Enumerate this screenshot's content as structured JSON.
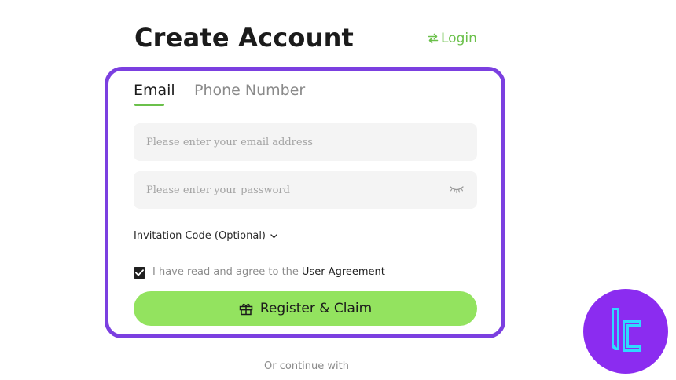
{
  "header": {
    "title": "Create Account",
    "login_label": "Login"
  },
  "tabs": {
    "email_label": "Email",
    "phone_label": "Phone Number",
    "active": "Email"
  },
  "form": {
    "email_placeholder": "Please enter your email address",
    "email_value": "",
    "password_placeholder": "Please enter your password",
    "password_value": "",
    "invitation_label": "Invitation Code (Optional)",
    "agreement_text": "I have read and agree to the",
    "agreement_link": "User Agreement",
    "agreement_checked": true,
    "register_label": "Register & Claim"
  },
  "footer": {
    "continue_text": "Or continue with"
  },
  "icons": {
    "login": "swap-arrows-icon",
    "password_toggle": "eye-closed-icon",
    "invitation": "chevron-down-icon",
    "checkbox": "checkmark-icon",
    "register": "gift-icon",
    "brand": "brand-logo-icon"
  },
  "colors": {
    "accent_green": "#6bc04b",
    "button_green": "#93e35f",
    "highlight_purple": "#7b3fe0",
    "badge_purple": "#8b2cf0",
    "badge_cyan": "#2fd9ff"
  }
}
